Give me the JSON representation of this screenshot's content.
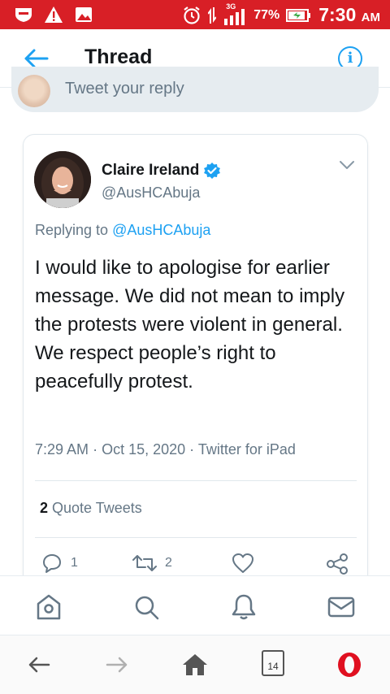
{
  "status_bar": {
    "network": "3G",
    "battery_percent": "77%",
    "time": "7:30",
    "ampm": "AM"
  },
  "header": {
    "title": "Thread"
  },
  "reply_bar": {
    "placeholder": "Tweet your reply"
  },
  "tweet": {
    "author_name": "Claire Ireland",
    "author_handle": "@AusHCAbuja",
    "verified": true,
    "replying_prefix": "Replying to",
    "replying_to": "@AusHCAbuja",
    "text": "I would like to apologise for earlier message. We did not mean to imply the protests were violent in general. We respect people’s right to peacefully protest.",
    "time": "7:29 AM",
    "date": "Oct 15, 2020",
    "source": "Twitter for iPad",
    "quote_count": "2",
    "quote_label": "Quote Tweets",
    "reply_count": "1",
    "retweet_count": "2"
  },
  "bottom_nav": {
    "items": [
      "home-icon",
      "search-icon",
      "notifications-icon",
      "messages-icon"
    ]
  },
  "browser": {
    "tab_count": "14"
  },
  "colors": {
    "status_bar": "#d81f26",
    "accent": "#1da1f2",
    "secondary_text": "#657786",
    "opera_red": "#e01020"
  }
}
